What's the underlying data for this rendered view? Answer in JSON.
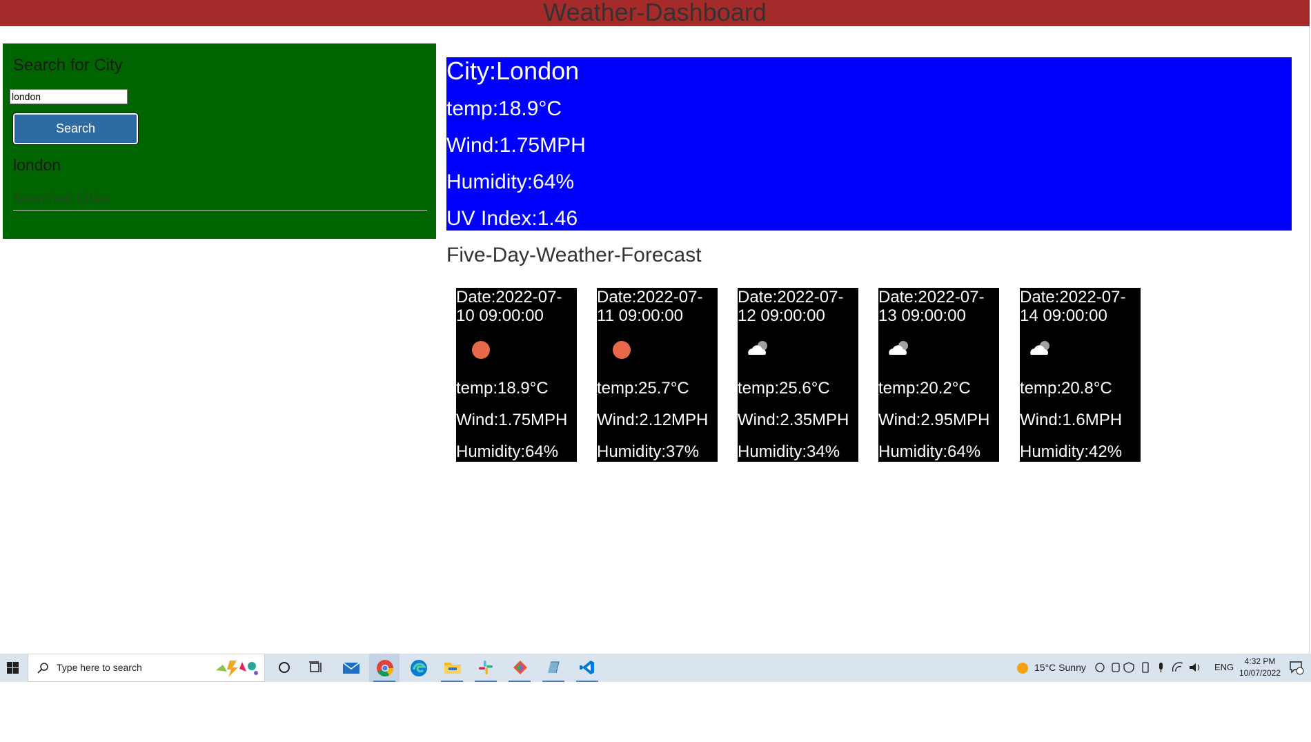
{
  "app": {
    "title": "Weather-Dashboard"
  },
  "sidebar": {
    "title": "Search for City",
    "input_value": "london",
    "search_label": "Search",
    "history": [
      "london"
    ],
    "searched_label": "Searched Cities"
  },
  "current": {
    "city": "City:London",
    "temp": "temp:18.9°C",
    "wind": "Wind:1.75MPH",
    "humidity": "Humidity:64%",
    "uv": "UV Index:1.46"
  },
  "forecast": {
    "title": "Five-Day-Weather-Forecast",
    "days": [
      {
        "date": "Date:2022-07-10 09:00:00",
        "icon": "sun-icon",
        "temp": "temp:18.9°C",
        "wind": "Wind:1.75MPH",
        "humidity": "Humidity:64%"
      },
      {
        "date": "Date:2022-07-11 09:00:00",
        "icon": "sun-icon",
        "temp": "temp:25.7°C",
        "wind": "Wind:2.12MPH",
        "humidity": "Humidity:37%"
      },
      {
        "date": "Date:2022-07-12 09:00:00",
        "icon": "cloud-icon",
        "temp": "temp:25.6°C",
        "wind": "Wind:2.35MPH",
        "humidity": "Humidity:34%"
      },
      {
        "date": "Date:2022-07-13 09:00:00",
        "icon": "cloud-icon",
        "temp": "temp:20.2°C",
        "wind": "Wind:2.95MPH",
        "humidity": "Humidity:64%"
      },
      {
        "date": "Date:2022-07-14 09:00:00",
        "icon": "cloud-icon",
        "temp": "temp:20.8°C",
        "wind": "Wind:1.6MPH",
        "humidity": "Humidity:42%"
      }
    ]
  },
  "taskbar": {
    "search_placeholder": "Type here to search",
    "apps": [
      "cortana-icon",
      "task-view-icon",
      "mail-icon",
      "chrome-icon",
      "edge-icon",
      "file-explorer-icon",
      "slack-icon",
      "git-icon",
      "app-icon",
      "vscode-icon"
    ],
    "weather": "15°C  Sunny",
    "language": "ENG",
    "time": "4:32 PM",
    "date": "10/07/2022"
  },
  "colors": {
    "header": "#a52a2a",
    "sidebar": "#006400",
    "current": "#0000ff",
    "card": "#000000",
    "button": "#2f6ba3",
    "sun": "#e8694a"
  }
}
